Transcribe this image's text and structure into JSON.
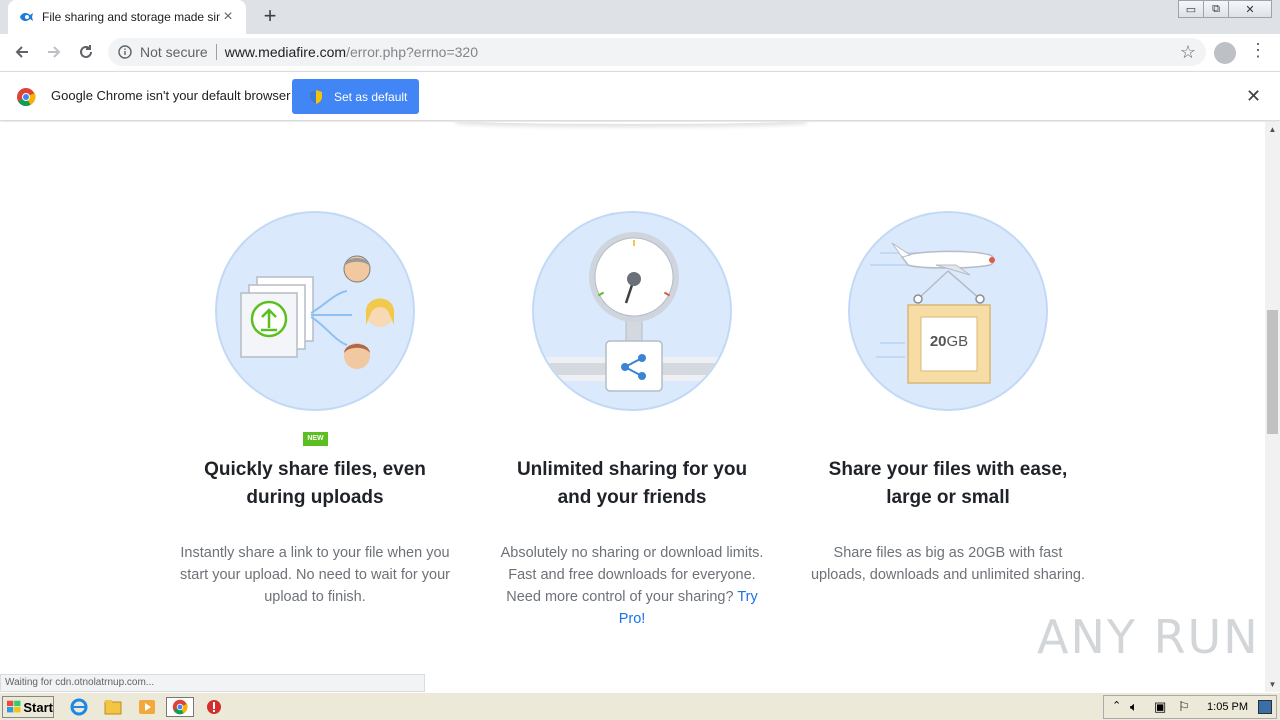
{
  "browser": {
    "tab": {
      "title": "File sharing and storage made simple",
      "favicon": "mediafire-icon"
    },
    "new_tab_glyph": "+",
    "window_controls": {
      "minimize": "▭",
      "restore": "⧉",
      "close": "✕"
    },
    "omnibox": {
      "security_label": "Not secure",
      "url_host": "www.mediafire.com",
      "url_path": "/error.php?errno=320"
    },
    "infobar": {
      "message": "Google Chrome isn't your default browser",
      "button_label": "Set as default"
    }
  },
  "features": [
    {
      "title_line1": "Quickly share files, even",
      "title_line2": "during uploads",
      "badge": "NEW",
      "description": "Instantly share a link to your file when you start your upload. No need to wait for your upload to finish."
    },
    {
      "title_line1": "Unlimited sharing for you",
      "title_line2": "and your friends",
      "description": "Absolutely no sharing or download limits. Fast and free downloads for everyone. Need more control of your sharing?",
      "link": "Try Pro!"
    },
    {
      "title_line1": "Share your files with ease,",
      "title_line2": "large or small",
      "box_label_bold": "20",
      "box_label_unit": "GB",
      "description": "Share files as big as 20GB with fast uploads, downloads and unlimited sharing."
    }
  ],
  "status_text": "Waiting for cdn.otnolatrnup.com...",
  "watermark": "ANY RUN",
  "taskbar": {
    "start_label": "Start",
    "clock": "1:05 PM"
  },
  "colors": {
    "accent": "#4285f4",
    "circle_bg": "#dbe9fc",
    "link": "#1a73e8",
    "new_badge": "#5bbf21"
  }
}
